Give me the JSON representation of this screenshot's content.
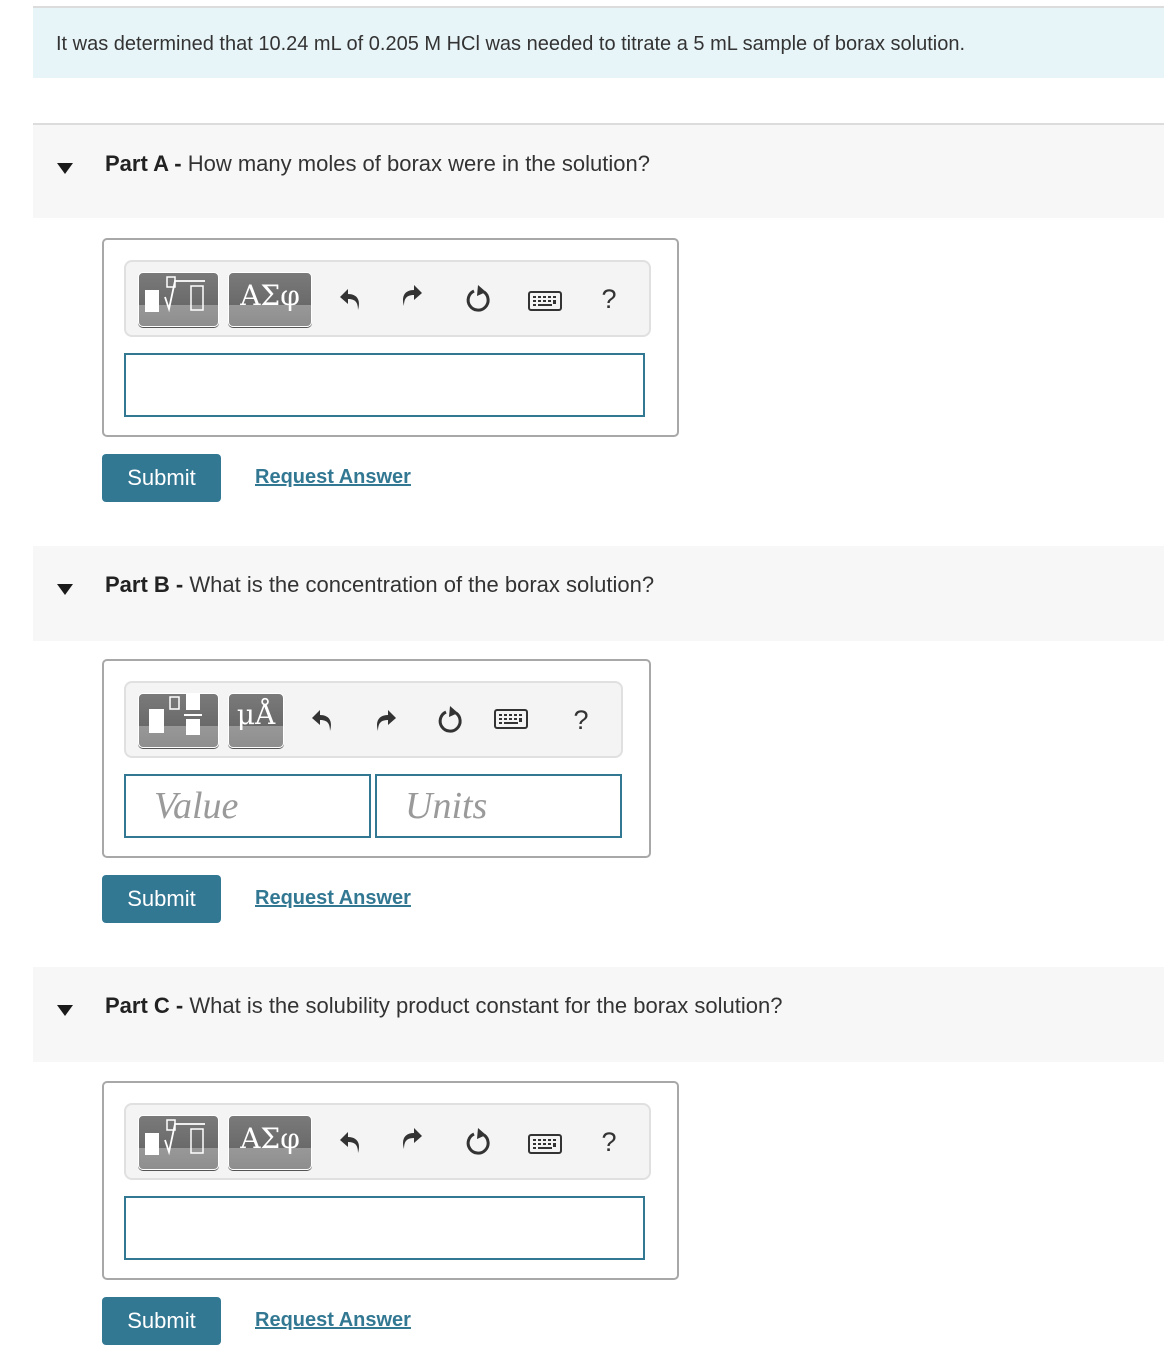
{
  "intro": {
    "text": "It was determined that 10.24 mL of 0.205 M HCl was needed to titrate a 5 mL sample of borax solution."
  },
  "parts": [
    {
      "label": "Part A -",
      "question": " How many moles of borax were in the solution?",
      "template_button": "templates-icon",
      "symbol_button": "ΑΣφ",
      "input_mode": "single",
      "answer_value": "",
      "submit_label": "Submit",
      "request_label": "Request Answer"
    },
    {
      "label": "Part B -",
      "question": " What is the concentration of the borax solution?",
      "template_button": "units-templates-icon",
      "symbol_button": "μÅ",
      "input_mode": "value-units",
      "value_placeholder": "Value",
      "units_placeholder": "Units",
      "submit_label": "Submit",
      "request_label": "Request Answer"
    },
    {
      "label": "Part C -",
      "question": " What is the solubility product constant for the borax solution?",
      "template_button": "templates-icon",
      "symbol_button": "ΑΣφ",
      "input_mode": "single",
      "answer_value": "",
      "submit_label": "Submit",
      "request_label": "Request Answer"
    }
  ],
  "toolbar": {
    "help_label": "?"
  },
  "colors": {
    "accent": "#337893",
    "intro_bg": "#e8f5f8",
    "part_header_bg": "#f7f7f7"
  }
}
